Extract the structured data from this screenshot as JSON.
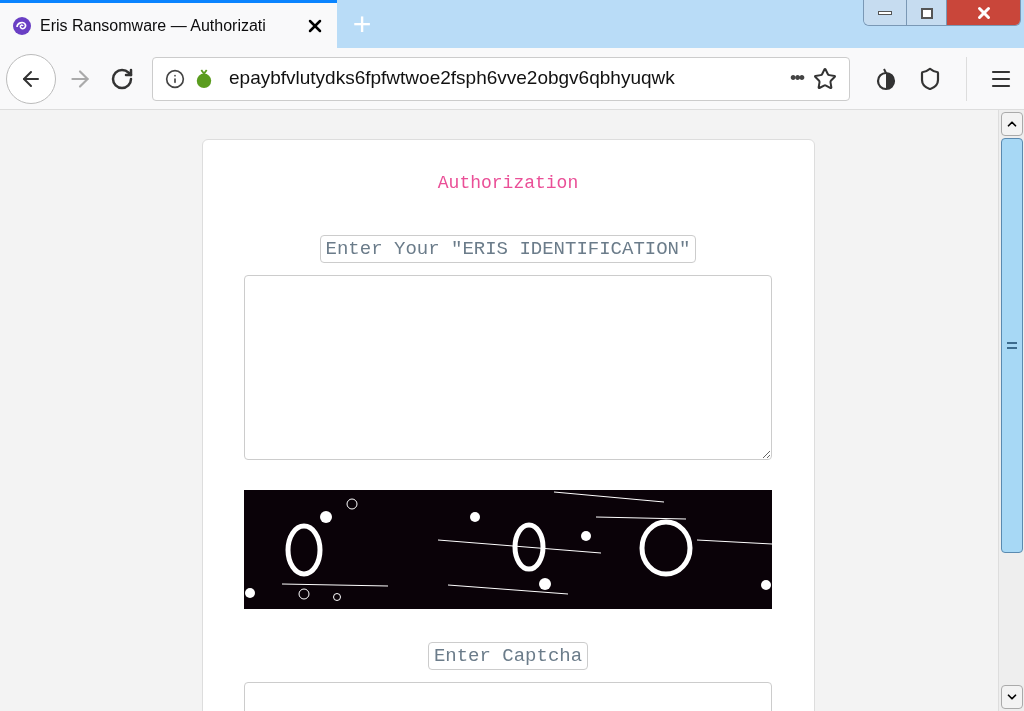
{
  "tab": {
    "title": "Eris Ransomware — Authorizati",
    "selected": true
  },
  "new_tab": {
    "label": "+"
  },
  "address_bar": {
    "url": "epaybfvlutydks6fpfwtwoe2fsph6vve2obgv6qbhyuqwk",
    "more": "•••"
  },
  "page": {
    "heading": "Authorization",
    "id_label": "Enter Your \"ERIS IDENTIFICATION\"",
    "captcha_label": "Enter Captcha"
  }
}
